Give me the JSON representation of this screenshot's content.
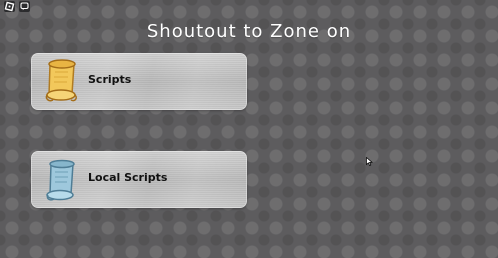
{
  "topbar": {
    "menu_icon": "roblox-logo-icon",
    "chat_icon": "chat-icon"
  },
  "page": {
    "title": "Shoutout to Zone on"
  },
  "buttons": [
    {
      "label": "Scripts",
      "icon": "parchment-scroll-icon",
      "icon_color": "#f2c85b"
    },
    {
      "label": "Local Scripts",
      "icon": "paper-scroll-icon",
      "icon_color": "#9ec8dc"
    }
  ],
  "colors": {
    "background": "#5d5c5e",
    "button_silver": "#c4c4c4",
    "title_text": "#ffffff",
    "label_text": "#111111"
  }
}
